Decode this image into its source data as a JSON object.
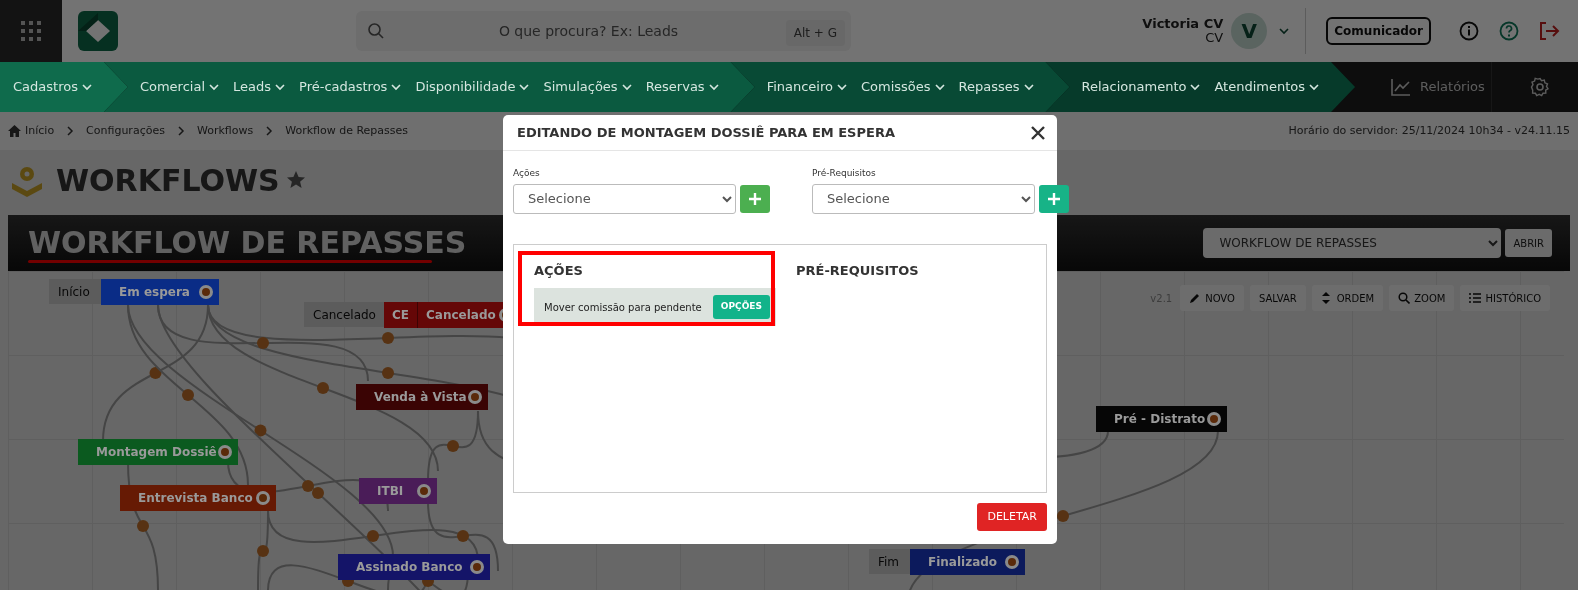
{
  "topbar": {
    "search": {
      "placeholder": "O que procura? Ex: Leads",
      "shortcut": "Alt + G"
    },
    "user": {
      "name": "Victoria CV",
      "company": "CV",
      "initial": "V"
    },
    "communicator_button": "Comunicador"
  },
  "nav": {
    "groups": [
      {
        "items": [
          "Cadastros"
        ]
      },
      {
        "items": [
          "Comercial",
          "Leads",
          "Pré-cadastros",
          "Disponibilidade",
          "Simulações",
          "Reservas"
        ]
      },
      {
        "items": [
          "Financeiro",
          "Comissões",
          "Repasses"
        ]
      },
      {
        "items": [
          "Relacionamento",
          "Atendimentos"
        ]
      }
    ],
    "reports": "Relatórios"
  },
  "breadcrumb": [
    "Início",
    "Configurações",
    "Workflows",
    "Workflow de Repasses"
  ],
  "server_time": "Horário do servidor: 25/11/2024 10h34 - v24.11.15",
  "page_title": "WORKFLOWS",
  "workflow": {
    "title": "WORKFLOW DE REPASSES",
    "select_value": "WORKFLOW DE REPASSES",
    "open_button": "ABRIR",
    "version": "v2.1",
    "toolbar": [
      "NOVO",
      "SALVAR",
      "ORDEM",
      "ZOOM",
      "HISTÓRICO"
    ],
    "nodes": [
      {
        "tag": "Início",
        "label": "Em espera",
        "color": "#0a2c86"
      },
      {
        "tag": "Cancelado",
        "code": "CE",
        "label": "Cancelado",
        "color": "#650707"
      },
      {
        "label": "Venda à Vista",
        "color": "#3a0404"
      },
      {
        "label": "Montagem Dossiê",
        "color": "#0b5a1f"
      },
      {
        "label": "Entrevista Banco",
        "color": "#661a04"
      },
      {
        "label": "ITBI",
        "color": "#4a1c58"
      },
      {
        "label": "Assinado Banco",
        "color": "#141468"
      },
      {
        "label": "Pré - Distrato",
        "color": "#060606"
      },
      {
        "tag": "Fim",
        "label": "Finalizado",
        "color": "#0c1a5c"
      }
    ]
  },
  "modal": {
    "title": "EDITANDO DE MONTAGEM DOSSIÊ PARA EM ESPERA",
    "actions_label": "Ações",
    "actions_placeholder": "Selecione",
    "prereq_label": "Pré-Requisitos",
    "prereq_placeholder": "Selecione",
    "actions_heading": "AÇÕES",
    "actions": [
      {
        "text": "Mover comissão para pendente",
        "button": "OPÇÕES"
      }
    ],
    "prereq_heading": "PRÉ-REQUISITOS",
    "delete_button": "DELETAR"
  }
}
